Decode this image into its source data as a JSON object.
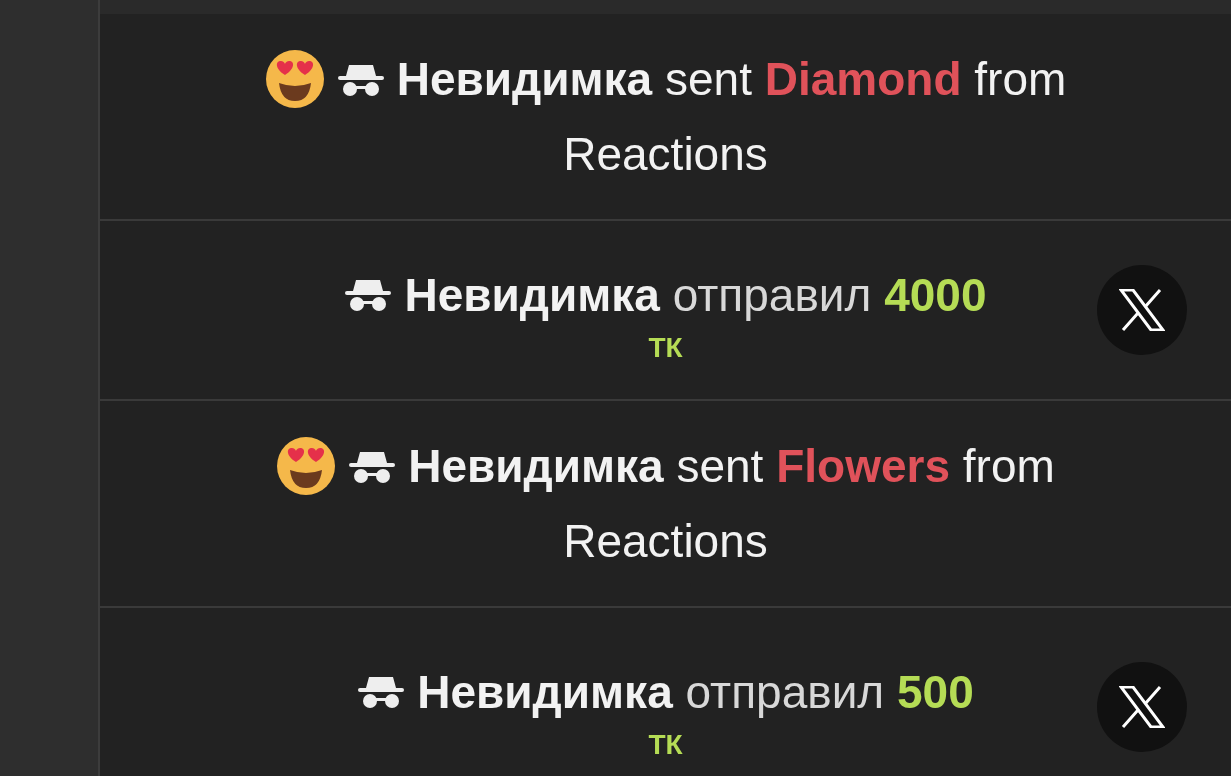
{
  "feed": [
    {
      "kind": "reaction",
      "emoji": true,
      "user": "Невидимка",
      "verb": "sent",
      "gift": "Diamond",
      "tail": "from Reactions"
    },
    {
      "kind": "tip",
      "user": "Невидимка",
      "verb": "отправил",
      "amount": "4000",
      "currency": "ТК",
      "dismissible": true
    },
    {
      "kind": "reaction",
      "emoji": true,
      "user": "Невидимка",
      "verb": "sent",
      "gift": "Flowers",
      "tail": "from Reactions"
    },
    {
      "kind": "tip",
      "user": "Невидимка",
      "verb": "отправил",
      "amount": "500",
      "currency": "ТК",
      "dismissible": true
    }
  ]
}
